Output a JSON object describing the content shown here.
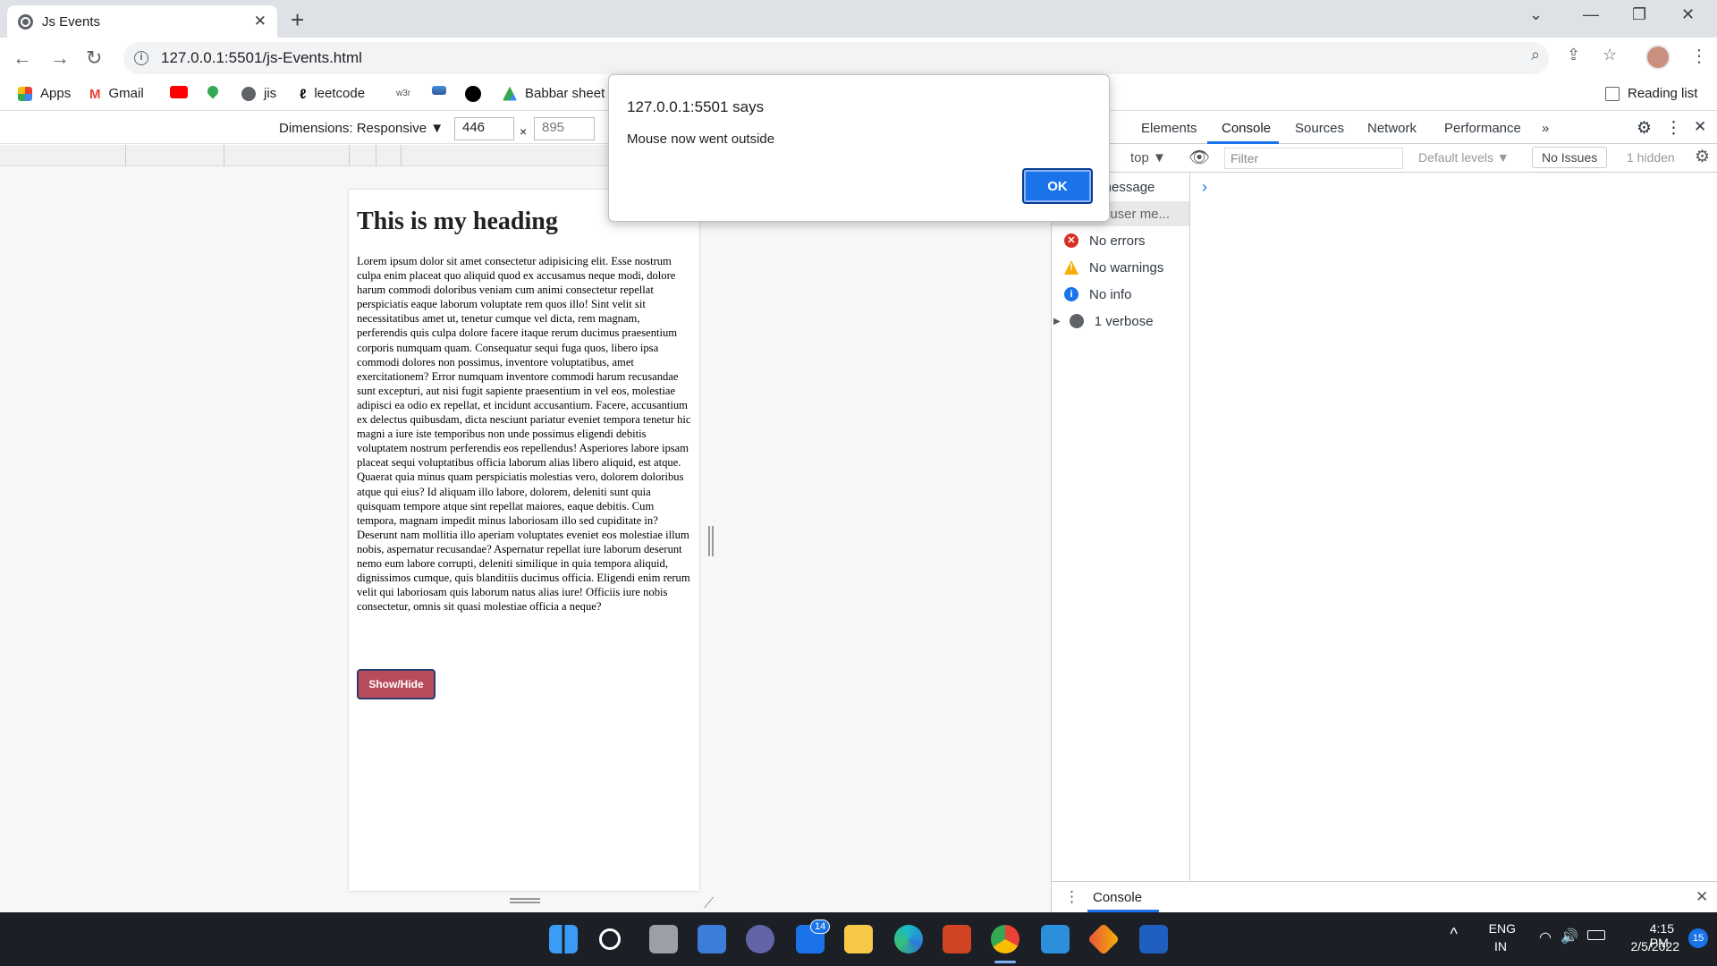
{
  "browser": {
    "tab_title": "Js Events",
    "url": "127.0.0.1:5501/js-Events.html",
    "bookmarks": [
      "Apps",
      "Gmail",
      "jis",
      "leetcode",
      "w3r",
      "Babbar sheet"
    ],
    "reading_list": "Reading list"
  },
  "device_toolbar": {
    "dimensions_label": "Dimensions: Responsive ▼",
    "width": "446",
    "height_placeholder": "895",
    "times": "×"
  },
  "page": {
    "heading": "This is my heading",
    "paragraph": "Lorem ipsum dolor sit amet consectetur adipisicing elit. Esse nostrum culpa enim placeat quo aliquid quod ex accusamus neque modi, dolore harum commodi doloribus veniam cum animi consectetur repellat perspiciatis eaque laborum voluptate rem quos illo! Sint velit sit necessitatibus amet ut, tenetur cumque vel dicta, rem magnam, perferendis quis culpa dolore facere itaque rerum ducimus praesentium corporis numquam quam. Consequatur sequi fuga quos, libero ipsa commodi dolores non possimus, inventore voluptatibus, amet exercitationem? Error numquam inventore commodi harum recusandae sunt excepturi, aut nisi fugit sapiente praesentium in vel eos, molestiae adipisci ea odio ex repellat, et incidunt accusantium. Facere, accusantium ex delectus quibusdam, dicta nesciunt pariatur eveniet tempora tenetur hic magni a iure iste temporibus non unde possimus eligendi debitis voluptatem nostrum perferendis eos repellendus! Asperiores labore ipsam placeat sequi voluptatibus officia laborum alias libero aliquid, est atque. Quaerat quia minus quam perspiciatis molestias vero, dolorem doloribus atque qui eius? Id aliquam illo labore, dolorem, deleniti sunt quia quisquam tempore atque sint repellat maiores, eaque debitis. Cum tempora, magnam impedit minus laboriosam illo sed cupiditate in? Deserunt nam mollitia illo aperiam voluptates eveniet eos molestiae illum nobis, aspernatur recusandae? Aspernatur repellat iure laborum deserunt nemo eum labore corrupti, deleniti similique in quia tempora aliquid, dignissimos cumque, quis blanditiis ducimus officia. Eligendi enim rerum velit qui laboriosam quis laborum natus alias iure! Officiis iure nobis consectetur, omnis sit quasi molestiae officia a neque?",
    "button": "Show/Hide"
  },
  "dialog": {
    "title": "127.0.0.1:5501 says",
    "message": "Mouse now went outside",
    "ok": "OK"
  },
  "devtools": {
    "tabs": [
      "Elements",
      "Console",
      "Sources",
      "Network",
      "Performance",
      "»"
    ],
    "context": "top ▼",
    "filter_placeholder": "Filter",
    "levels": "Default levels ▼",
    "issues": "No Issues",
    "hidden": "1 hidden",
    "sidebar": [
      "1 message",
      "No user me...",
      "No errors",
      "No warnings",
      "No info",
      "1 verbose"
    ],
    "drawer_tab": "Console",
    "prompt": "›"
  },
  "taskbar": {
    "lang": "ENG",
    "region": "IN",
    "time": "4:15 PM",
    "date": "2/5/2022",
    "mail_badge": "14",
    "notif_badge": "15"
  },
  "colors": {
    "accent": "#1a73e8",
    "button": "#b84b5c"
  }
}
